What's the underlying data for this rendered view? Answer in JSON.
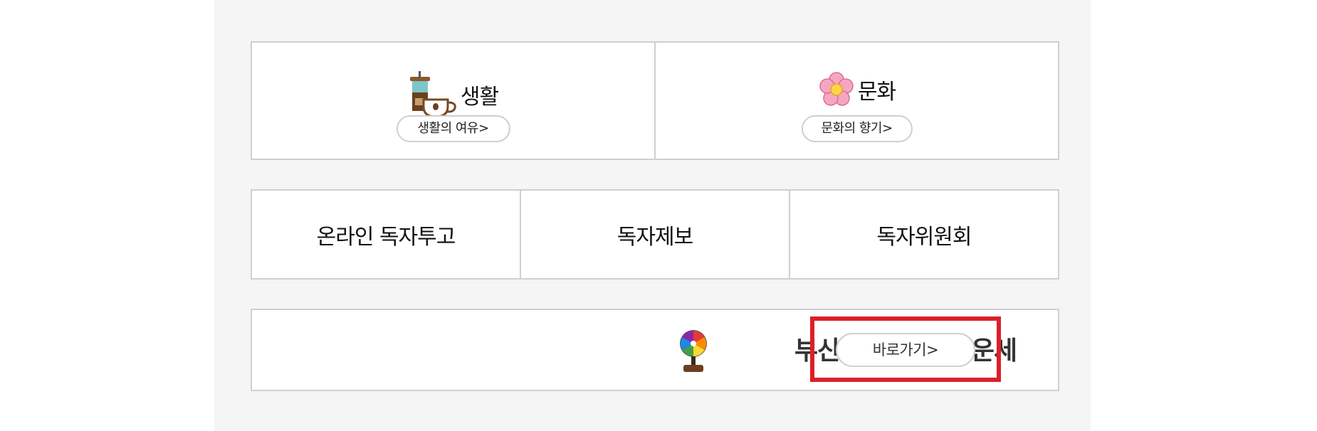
{
  "life": {
    "title": "생활",
    "link_label": "생활의 여유>",
    "icon": "coffee-icon"
  },
  "culture": {
    "title": "문화",
    "link_label": "문화의 향기>",
    "icon": "flower-icon"
  },
  "reader_links": [
    {
      "label": "온라인 독자투고"
    },
    {
      "label": "독자제보"
    },
    {
      "label": "독자위원회"
    }
  ],
  "fortune": {
    "title": "부산일보 오늘의 운세",
    "button_label": "바로가기>",
    "icon": "fortune-wheel-icon"
  },
  "colors": {
    "panel_background": "#f5f5f5",
    "border": "#cfcfcf",
    "highlight": "#dd1f2a"
  }
}
